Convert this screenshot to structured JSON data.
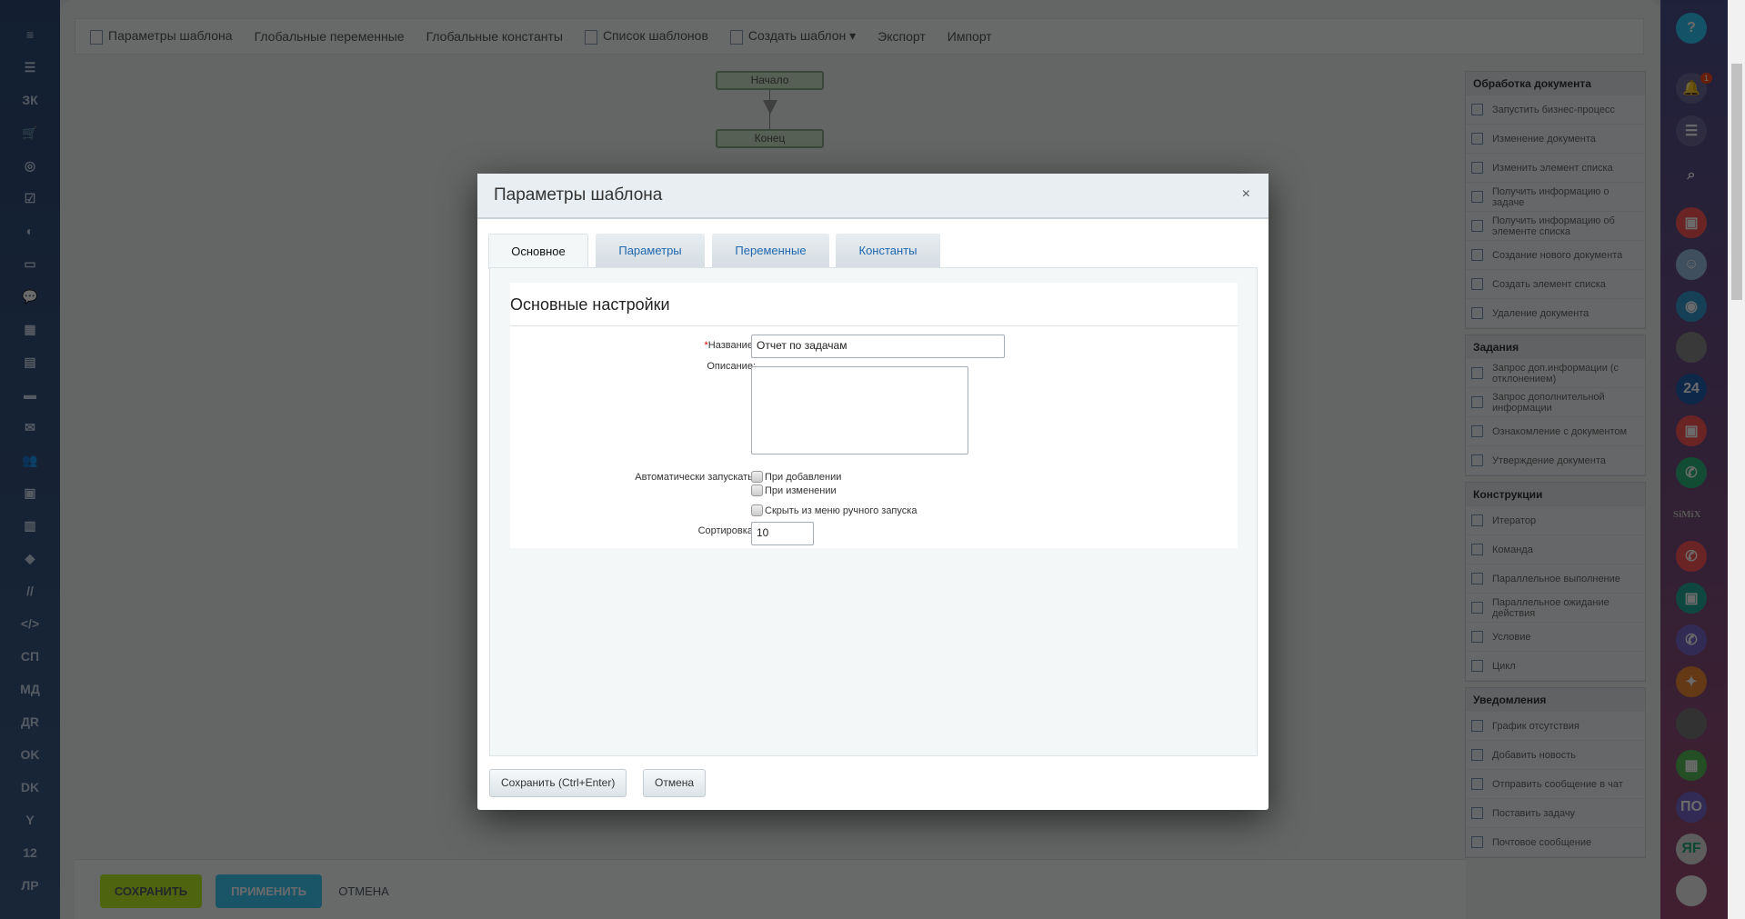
{
  "left_sidebar": {
    "items": [
      "≡",
      "☰",
      "ЗК",
      "🛒",
      "◎",
      "☑",
      "◐",
      "▭",
      "💬",
      "▦",
      "▤",
      "▬",
      "✉",
      "👥",
      "▣",
      "▥",
      "◆",
      "//",
      "</>",
      "СП",
      "МД",
      "ДR",
      "OK",
      "DK",
      "Y",
      "12",
      "ЛР"
    ]
  },
  "toolbar": {
    "items": [
      "Параметры шаблона",
      "Глобальные переменные",
      "Глобальные константы",
      "Список шаблонов",
      "Создать шаблон ▾",
      "Экспорт",
      "Импорт"
    ]
  },
  "flow": {
    "start": "Начало",
    "end": "Конец"
  },
  "activities": [
    {
      "title": "Обработка документа",
      "items": [
        "Запустить бизнес-процесс",
        "Изменение документа",
        "Изменить элемент списка",
        "Получить информацию о задаче",
        "Получить информацию об элементе списка",
        "Создание нового документа",
        "Создать элемент списка",
        "Удаление документа"
      ]
    },
    {
      "title": "Задания",
      "items": [
        "Запрос доп.информации (с отклонением)",
        "Запрос дополнительной информации",
        "Ознакомление с документом",
        "Утверждение документа"
      ]
    },
    {
      "title": "Конструкции",
      "items": [
        "Итератор",
        "Команда",
        "Параллельное выполнение",
        "Параллельное ожидание действия",
        "Условие",
        "Цикл"
      ]
    },
    {
      "title": "Уведомления",
      "items": [
        "График отсутствия",
        "Добавить новость",
        "Отправить сообщение в чат",
        "Поставить задачу",
        "Почтовое сообщение"
      ]
    }
  ],
  "bottom_bar": {
    "save": "СОХРАНИТЬ",
    "apply": "ПРИМЕНИТЬ",
    "cancel": "ОТМЕНА"
  },
  "right_sidebar": {
    "notification_count": "1",
    "badge_24": "24",
    "simix": "SiMiX",
    "po": "ПО",
    "rf": "ЯF"
  },
  "dialog": {
    "title": "Параметры шаблона",
    "close": "×",
    "tabs": [
      "Основное",
      "Параметры",
      "Переменные",
      "Константы"
    ],
    "section_title": "Основные настройки",
    "name_required_mark": "*",
    "name_label": "Название:",
    "name_value": "Отчет по задачам",
    "description_label": "Описание:",
    "description_value": "",
    "autorun_label": "Автоматически запускать:",
    "on_add": "При добавлении",
    "on_change": "При изменении",
    "hide_manual": "Скрыть из меню ручного запуска",
    "sort_label": "Сортировка:",
    "sort_value": "10",
    "save_button": "Сохранить (Ctrl+Enter)",
    "cancel_button": "Отмена"
  }
}
